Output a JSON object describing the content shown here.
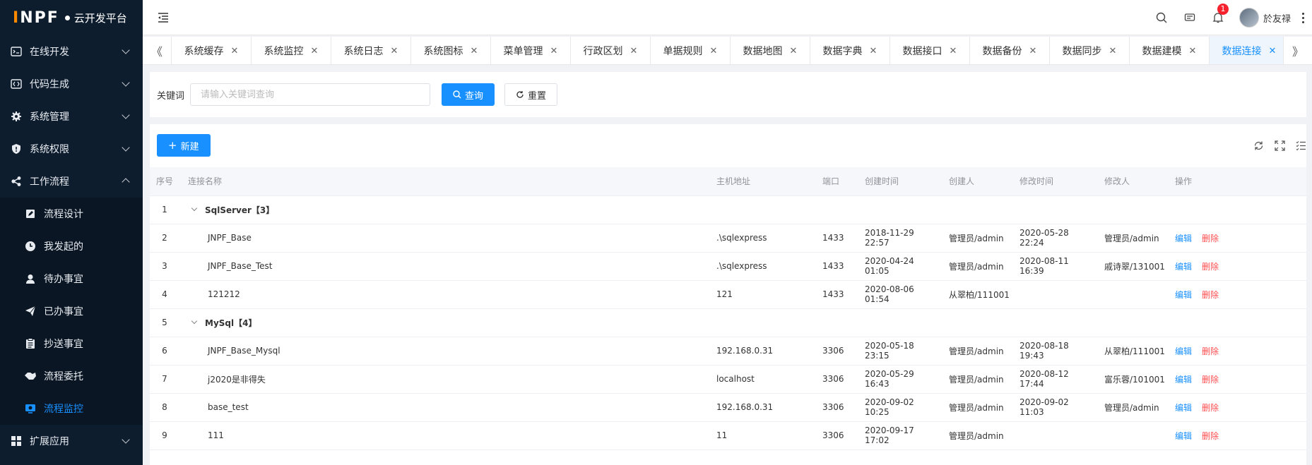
{
  "brand": {
    "mark_pre": "I",
    "mark_mid": "N",
    "mark_post": "PF",
    "name": "云开发平台"
  },
  "sidebar": {
    "items": [
      {
        "label": "在线开发",
        "icon": "code-window-icon"
      },
      {
        "label": "代码生成",
        "icon": "code-file-icon"
      },
      {
        "label": "系统管理",
        "icon": "gear-icon"
      },
      {
        "label": "系统权限",
        "icon": "shield-icon"
      },
      {
        "label": "工作流程",
        "icon": "share-nodes-icon"
      }
    ],
    "submenu": [
      {
        "label": "流程设计",
        "icon": "pen-icon"
      },
      {
        "label": "我发起的",
        "icon": "clock-icon"
      },
      {
        "label": "待办事宜",
        "icon": "user-icon"
      },
      {
        "label": "已办事宜",
        "icon": "send-icon"
      },
      {
        "label": "抄送事宜",
        "icon": "clipboard-icon"
      },
      {
        "label": "流程委托",
        "icon": "handshake-icon"
      },
      {
        "label": "流程监控",
        "icon": "monitor-icon"
      }
    ],
    "last": {
      "label": "扩展应用",
      "icon": "grid-icon"
    }
  },
  "header": {
    "notification_count": "1",
    "username": "於友禄"
  },
  "tabs": [
    "系统缓存",
    "系统监控",
    "系统日志",
    "系统图标",
    "菜单管理",
    "行政区划",
    "单据规则",
    "数据地图",
    "数据字典",
    "数据接口",
    "数据备份",
    "数据同步",
    "数据建模",
    "数据连接"
  ],
  "search": {
    "label": "关键词",
    "placeholder": "请输入关键词查询",
    "query_btn": "查询",
    "reset_btn": "重置"
  },
  "toolbar": {
    "new_btn": "新建"
  },
  "table": {
    "headers": [
      "序号",
      "连接名称",
      "主机地址",
      "端口",
      "创建时间",
      "创建人",
      "修改时间",
      "修改人",
      "操作"
    ],
    "edit_label": "编辑",
    "delete_label": "删除",
    "rows": [
      {
        "idx": "1",
        "group": "SqlServer【3】"
      },
      {
        "idx": "2",
        "name": "JNPF_Base",
        "host": ".\\sqlexpress",
        "port": "1433",
        "created": "2018-11-29 22:57",
        "creator": "管理员/admin",
        "modified": "2020-05-28 22:24",
        "modifier": "管理员/admin"
      },
      {
        "idx": "3",
        "name": "JNPF_Base_Test",
        "host": ".\\sqlexpress",
        "port": "1433",
        "created": "2020-04-24 01:05",
        "creator": "管理员/admin",
        "modified": "2020-08-11 16:39",
        "modifier": "戚诗翠/131001"
      },
      {
        "idx": "4",
        "name": "121212",
        "host": "121",
        "port": "1433",
        "created": "2020-08-06 01:54",
        "creator": "从翠柏/111001",
        "modified": "",
        "modifier": ""
      },
      {
        "idx": "5",
        "group": "MySql【4】"
      },
      {
        "idx": "6",
        "name": "JNPF_Base_Mysql",
        "host": "192.168.0.31",
        "port": "3306",
        "created": "2020-05-18 23:15",
        "creator": "管理员/admin",
        "modified": "2020-08-18 19:43",
        "modifier": "从翠柏/111001"
      },
      {
        "idx": "7",
        "name": "j2020是非得失",
        "host": "localhost",
        "port": "3306",
        "created": "2020-05-29 16:43",
        "creator": "管理员/admin",
        "modified": "2020-08-12 17:44",
        "modifier": "富乐蓉/101001"
      },
      {
        "idx": "8",
        "name": "base_test",
        "host": "192.168.0.31",
        "port": "3306",
        "created": "2020-09-02 10:25",
        "creator": "管理员/admin",
        "modified": "2020-09-02 11:03",
        "modifier": "管理员/admin"
      },
      {
        "idx": "9",
        "name": "111",
        "host": "11",
        "port": "3306",
        "created": "2020-09-17 17:02",
        "creator": "管理员/admin",
        "modified": "",
        "modifier": ""
      }
    ]
  },
  "colors": {
    "primary": "#1890ff",
    "danger": "#ff4d4f",
    "sidebar_bg": "#0e1d2e",
    "logo_accent": "#ff8a00"
  }
}
